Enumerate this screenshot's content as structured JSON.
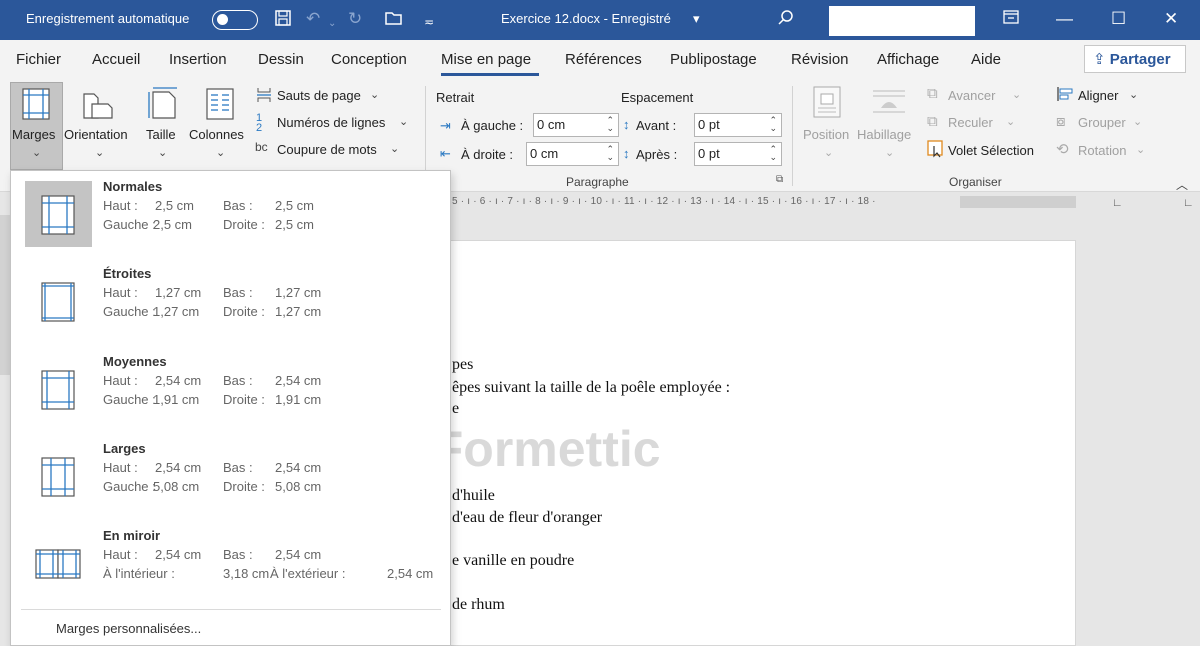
{
  "titlebar": {
    "autosave_label": "Enregistrement automatique",
    "doc_title": "Exercice 12.docx  -  Enregistré",
    "doc_title_chevron": "▾",
    "icons": [
      "save-icon",
      "undo-icon",
      "redo-icon",
      "open-icon",
      "customize-icon",
      "search-icon",
      "ribbon-display-icon",
      "minimize-icon",
      "maximize-icon",
      "close-icon"
    ]
  },
  "menu": {
    "tabs": [
      "Fichier",
      "Accueil",
      "Insertion",
      "Dessin",
      "Conception",
      "Mise en page",
      "Références",
      "Publipostage",
      "Révision",
      "Affichage",
      "Aide"
    ],
    "active_tab": "Mise en page",
    "share_label": "Partager"
  },
  "ribbon": {
    "marges": "Marges",
    "orientation": "Orientation",
    "taille": "Taille",
    "colonnes": "Colonnes",
    "sauts": "Sauts de page",
    "numeros": "Numéros de lignes",
    "coupure": "Coupure de mots",
    "retrait": "Retrait",
    "espacement": "Espacement",
    "a_gauche_label": "À gauche :",
    "a_gauche_value": "0 cm",
    "a_droite_label": "À droite :",
    "a_droite_value": "0 cm",
    "avant_label": "Avant :",
    "avant_value": "0 pt",
    "apres_label": "Après :",
    "apres_value": "0 pt",
    "paragraphe": "Paragraphe",
    "position": "Position",
    "habillage": "Habillage",
    "avancer": "Avancer",
    "reculer": "Reculer",
    "volet": "Volet Sélection",
    "aligner": "Aligner",
    "grouper": "Grouper",
    "rotation": "Rotation",
    "organiser": "Organiser",
    "ruler": "5 · ı · 6 · ı · 7 · ı · 8 · ı · 9 · ı · 10 · ı · 11 · ı · 12 · ı · 13 · ı · 14 · ı · 15 · ı · 16 · ı · 17 · ı · 18 ·"
  },
  "document": {
    "lines": [
      "pes",
      "êpes suivant la taille de la poêle employée :",
      "e",
      "d'huile",
      "d'eau de fleur d'oranger",
      "e vanille en poudre",
      "de rhum"
    ],
    "watermark": "© Formettic"
  },
  "margins_menu": {
    "options": [
      {
        "title": "Normales",
        "haut_label": "Haut :",
        "haut": "2,5 cm",
        "bas_label": "Bas :",
        "bas": "2,5 cm",
        "gauche_label": "Gauche :",
        "gauche": "2,5 cm",
        "droite_label": "Droite :",
        "droite": "2,5 cm"
      },
      {
        "title": "Étroites",
        "haut_label": "Haut :",
        "haut": "1,27 cm",
        "bas_label": "Bas :",
        "bas": "1,27 cm",
        "gauche_label": "Gauche :",
        "gauche": "1,27 cm",
        "droite_label": "Droite :",
        "droite": "1,27 cm"
      },
      {
        "title": "Moyennes",
        "haut_label": "Haut :",
        "haut": "2,54 cm",
        "bas_label": "Bas :",
        "bas": "2,54 cm",
        "gauche_label": "Gauche :",
        "gauche": "1,91 cm",
        "droite_label": "Droite :",
        "droite": "1,91 cm"
      },
      {
        "title": "Larges",
        "haut_label": "Haut :",
        "haut": "2,54 cm",
        "bas_label": "Bas :",
        "bas": "2,54 cm",
        "gauche_label": "Gauche :",
        "gauche": "5,08 cm",
        "droite_label": "Droite :",
        "droite": "5,08 cm"
      },
      {
        "title": "En miroir",
        "haut_label": "Haut :",
        "haut": "2,54 cm",
        "bas_label": "Bas :",
        "bas": "2,54 cm",
        "gauche_label": "À l'intérieur :",
        "gauche": "3,18 cm",
        "droite_label": "À l'extérieur :",
        "droite": "2,54 cm"
      }
    ],
    "selected": "Normales",
    "custom_label": "Marges personnalisées..."
  },
  "colors": {
    "title_bar": "#2b579a",
    "accent": "#2b579a",
    "ribbon_bg": "#f3f3f3",
    "selected_bg": "#c4c4c4"
  }
}
